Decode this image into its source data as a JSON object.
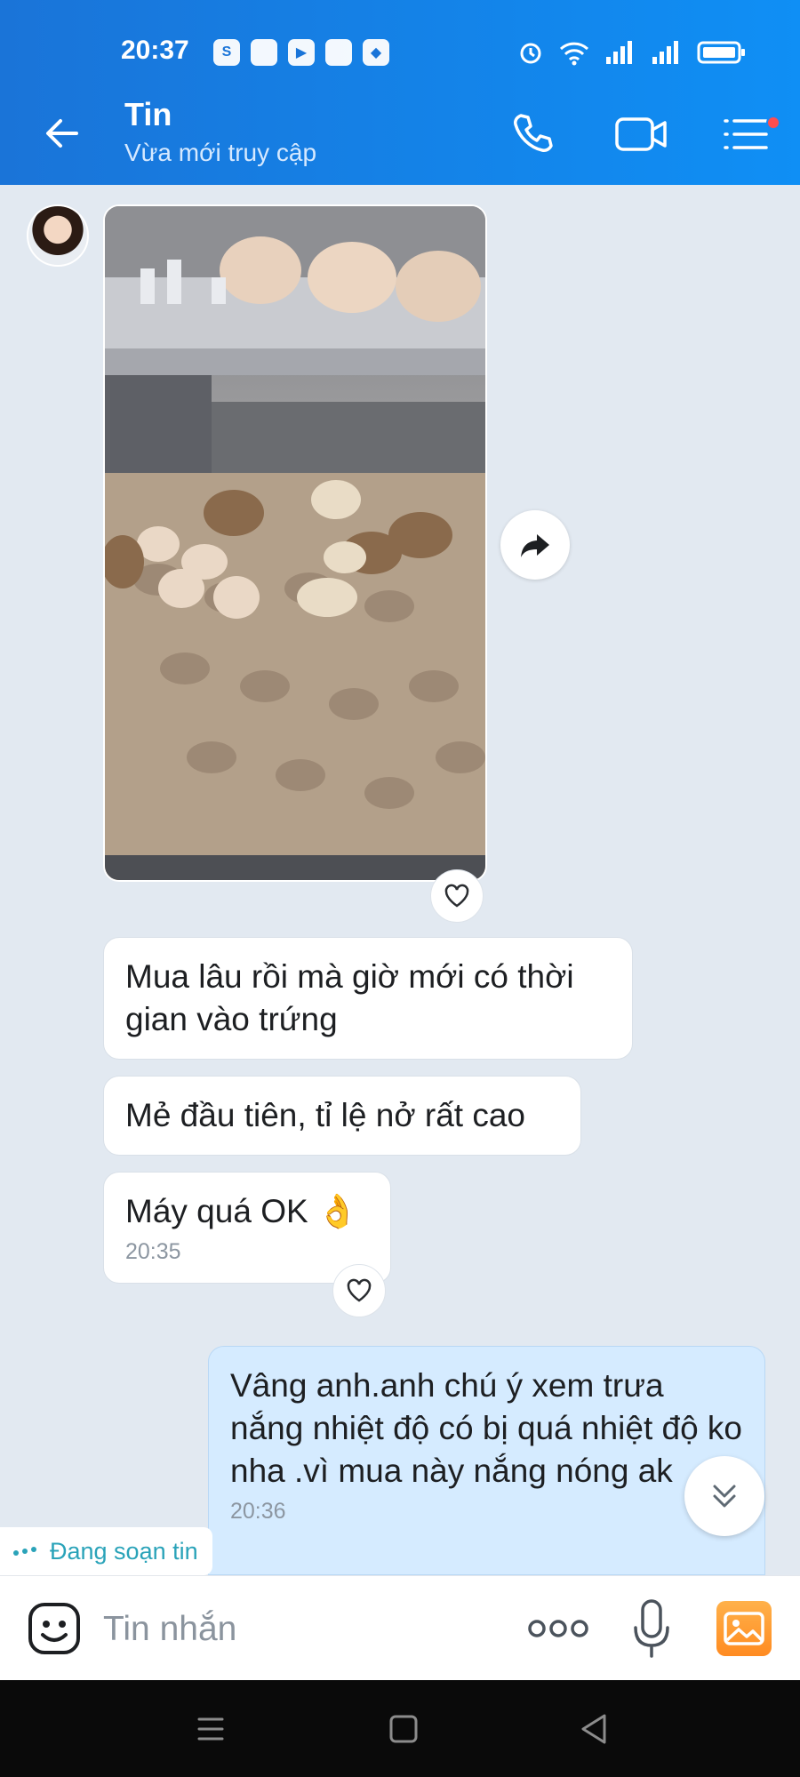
{
  "status_bar": {
    "time": "20:37",
    "apps": [
      "S",
      "",
      "▶",
      "",
      "◆"
    ],
    "icons": [
      "alarm-icon",
      "wifi-icon",
      "signal-icon",
      "signal-icon",
      "battery-icon"
    ]
  },
  "header": {
    "title": "Tin",
    "subtitle": "Vừa mới truy cập",
    "icons": [
      "back-arrow-icon",
      "phone-icon",
      "video-call-icon",
      "menu-icon"
    ]
  },
  "messages": [
    {
      "type": "image",
      "content": "photo of chicks hatching in an egg incubator"
    },
    {
      "type": "text",
      "text": "Mua lâu rồi mà giờ mới có thời gian vào trứng"
    },
    {
      "type": "text",
      "text": "Mẻ đầu tiên, tỉ lệ nở rất cao"
    },
    {
      "type": "text",
      "text": "Máy quá OK 👌",
      "time": "20:35"
    },
    {
      "type": "text",
      "mine": true,
      "text": "Vâng anh.anh chú ý xem trưa nắng nhiệt độ có bị quá nhiệt độ ko nha .vì mua này nắng nóng ak",
      "time": "20:36"
    }
  ],
  "typing_indicator": "Đang soạn tin",
  "composer": {
    "placeholder": "Tin nhắn",
    "more_label": "○○○"
  },
  "colors": {
    "brand_blue": "#1a74d8",
    "my_bubble": "#d5ebff",
    "typing": "#2aa3b9",
    "gallery": "#ff8b21"
  }
}
